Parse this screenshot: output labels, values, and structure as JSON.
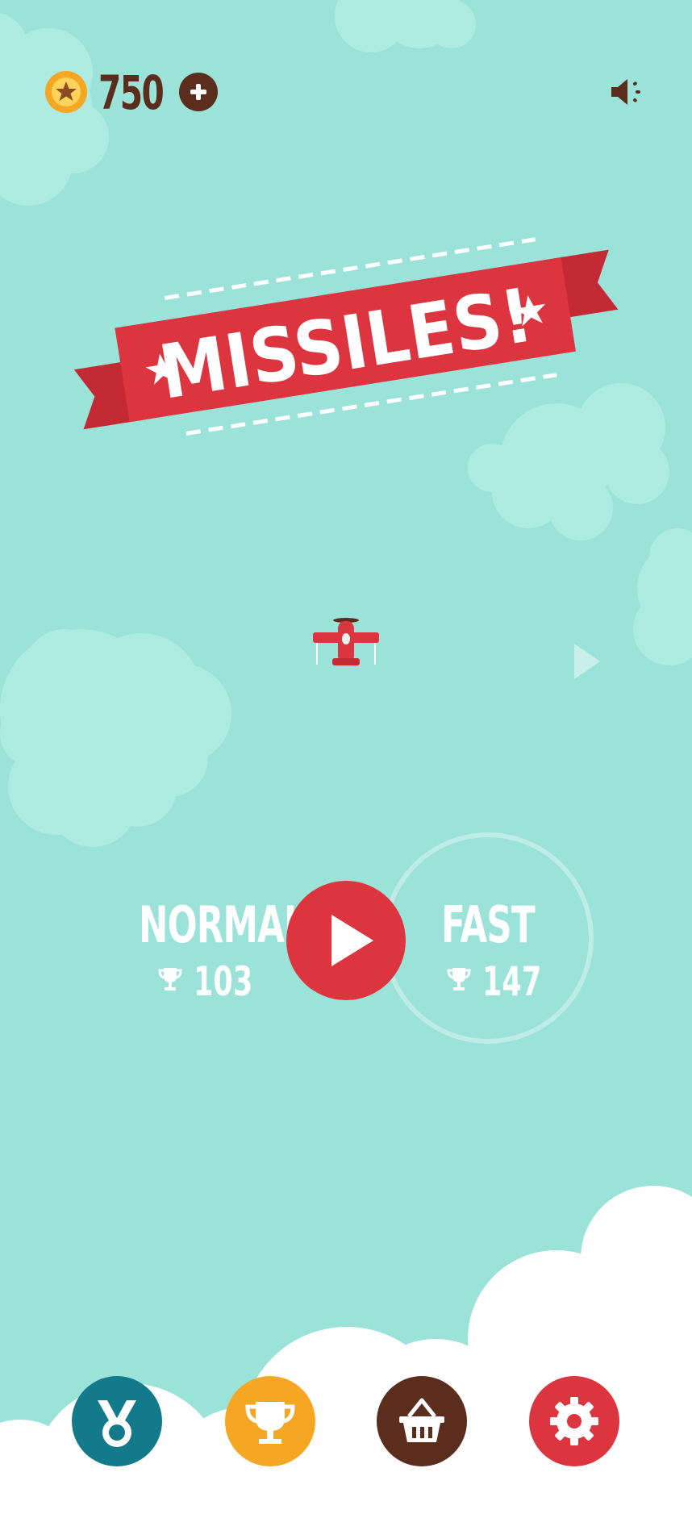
{
  "header": {
    "coins": "750",
    "coin_icon": "star-coin-icon",
    "add_icon": "plus-icon",
    "sound_icon": "speaker-icon"
  },
  "title": {
    "text": "MISSILES!"
  },
  "modes": [
    {
      "name": "NORMAL",
      "best_score": "103",
      "icon": "trophy-icon"
    },
    {
      "name": "FAST",
      "best_score": "147",
      "icon": "trophy-icon"
    }
  ],
  "play": {
    "icon": "play-icon"
  },
  "bottom_nav": [
    {
      "id": "achievements",
      "icon": "medal-icon",
      "color": "#137a8c"
    },
    {
      "id": "leaderboard",
      "icon": "trophy-icon",
      "color": "#f5a623"
    },
    {
      "id": "shop",
      "icon": "basket-icon",
      "color": "#5a2d1c"
    },
    {
      "id": "settings",
      "icon": "gear-icon",
      "color": "#dc3540"
    }
  ],
  "colors": {
    "sky": "#9be2d9",
    "cloud_light": "#aeebe3",
    "banner_red": "#dc3540",
    "brown": "#5a2d1c",
    "orange": "#f5a623",
    "teal": "#137a8c"
  }
}
